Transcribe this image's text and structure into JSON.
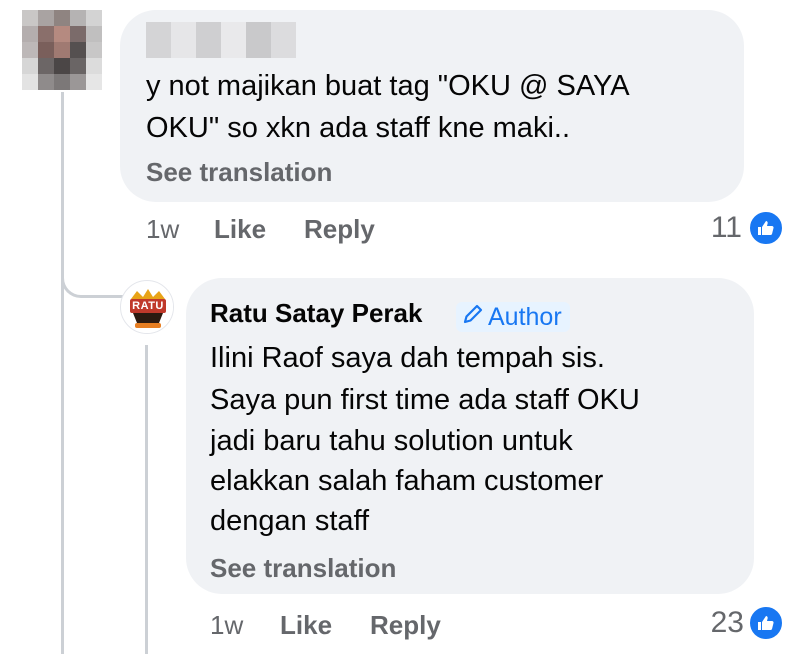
{
  "comment1": {
    "text_line1": "y not majikan buat tag \"OKU @ SAYA",
    "text_line2": "OKU\" so xkn ada staff kne maki..",
    "see_translation": "See translation",
    "time": "1w",
    "like_label": "Like",
    "reply_label": "Reply",
    "reaction_count": "11",
    "reaction_icon": "thumbs-up-icon"
  },
  "reply1": {
    "author": "Ratu Satay Perak",
    "badge_label": "Author",
    "badge_icon": "pencil-icon",
    "avatar_text": "RATU",
    "text_lines": [
      "Ilini Raof saya dah tempah sis.",
      "Saya pun first time ada staff OKU",
      "jadi baru tahu solution untuk",
      "elakkan salah faham customer",
      "dengan staff"
    ],
    "see_translation": "See translation",
    "time": "1w",
    "like_label": "Like",
    "reply_label": "Reply",
    "reaction_count": "23",
    "reaction_icon": "thumbs-up-icon"
  },
  "colors": {
    "bubble_bg": "#f0f2f5",
    "secondary_text": "#65676b",
    "accent_blue": "#1877f2",
    "badge_bg": "#e7f3ff",
    "thread_line": "#ccd0d5"
  }
}
